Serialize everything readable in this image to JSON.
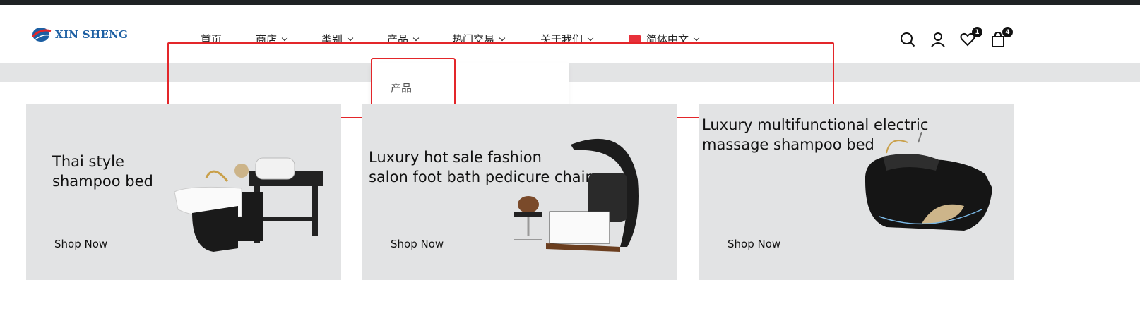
{
  "header": {
    "logo_text": "XIN SHENG",
    "nav": [
      {
        "label": "首页"
      },
      {
        "label": "商店"
      },
      {
        "label": "类别"
      },
      {
        "label": "产品"
      },
      {
        "label": "热门交易"
      },
      {
        "label": "关于我们"
      },
      {
        "label": "简体中文"
      }
    ],
    "wishlist_count": "1",
    "cart_count": "4"
  },
  "dropdown": {
    "item": "产品"
  },
  "cards": [
    {
      "title": "Thai style\nshampoo bed",
      "link": "Shop Now"
    },
    {
      "title": "Luxury hot sale fashion\nsalon foot bath pedicure chair",
      "link": "Shop Now"
    },
    {
      "title": "Luxury multifunctional electric\nmassage shampoo bed",
      "link": "Shop Now"
    }
  ],
  "colors": {
    "accent_red": "#e3262a",
    "logo_blue": "#1c5fa3",
    "card_bg": "#e2e3e4"
  }
}
